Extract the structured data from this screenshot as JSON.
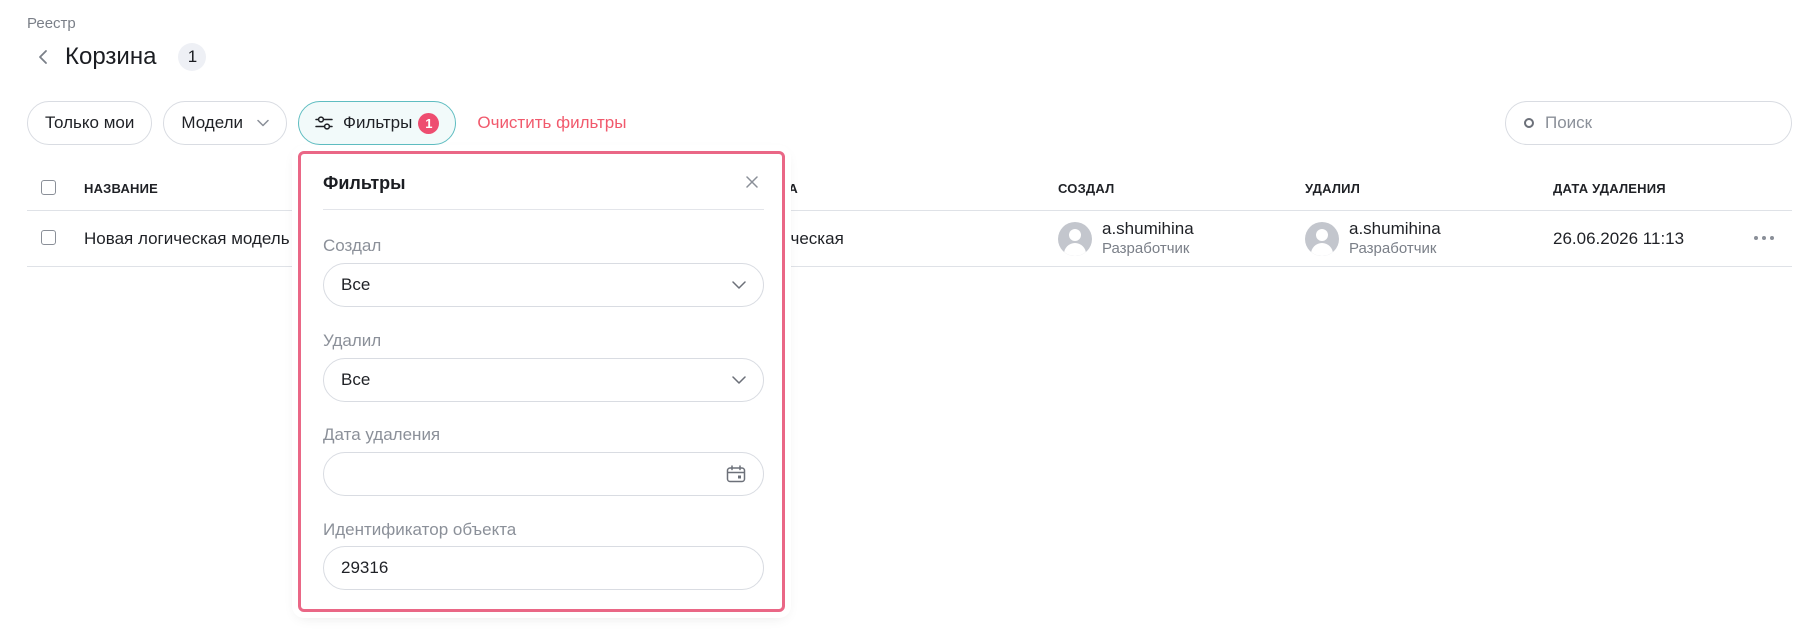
{
  "breadcrumb": "Реестр",
  "header": {
    "title": "Корзина",
    "count": "1"
  },
  "toolbar": {
    "only_mine": "Только мои",
    "models": "Модели",
    "filters": "Фильтры",
    "filters_count": "1",
    "clear_filters": "Очистить фильтры"
  },
  "search": {
    "placeholder": "Поиск"
  },
  "table": {
    "columns": {
      "name": "НАЗВАНИЕ",
      "type_partial": "ТА",
      "created_by": "СОЗДАЛ",
      "deleted_by": "УДАЛИЛ",
      "deleted_at": "ДАТА УДАЛЕНИЯ"
    },
    "rows": [
      {
        "name": "Новая логическая модель",
        "type_partial": "ическая",
        "created_by": {
          "name": "a.shumihina",
          "role": "Разработчик"
        },
        "deleted_by": {
          "name": "a.shumihina",
          "role": "Разработчик"
        },
        "deleted_at": "26.06.2026 11:13"
      }
    ]
  },
  "filter_panel": {
    "title": "Фильтры",
    "created_label": "Создал",
    "created_value": "Все",
    "deleted_label": "Удалил",
    "deleted_value": "Все",
    "date_label": "Дата удаления",
    "date_value": "",
    "object_id_label": "Идентификатор объекта",
    "object_id_value": "29316"
  },
  "colors": {
    "accent_teal": "#5fbdc1",
    "badge_pink": "#ee4d70",
    "clear_link": "#f1596c",
    "highlight_border": "#ea6786"
  },
  "icons": [
    "chevron-left-icon",
    "chevron-down-icon",
    "sliders-icon",
    "search-icon",
    "close-icon",
    "calendar-icon",
    "user-avatar-icon",
    "more-dots-icon"
  ]
}
